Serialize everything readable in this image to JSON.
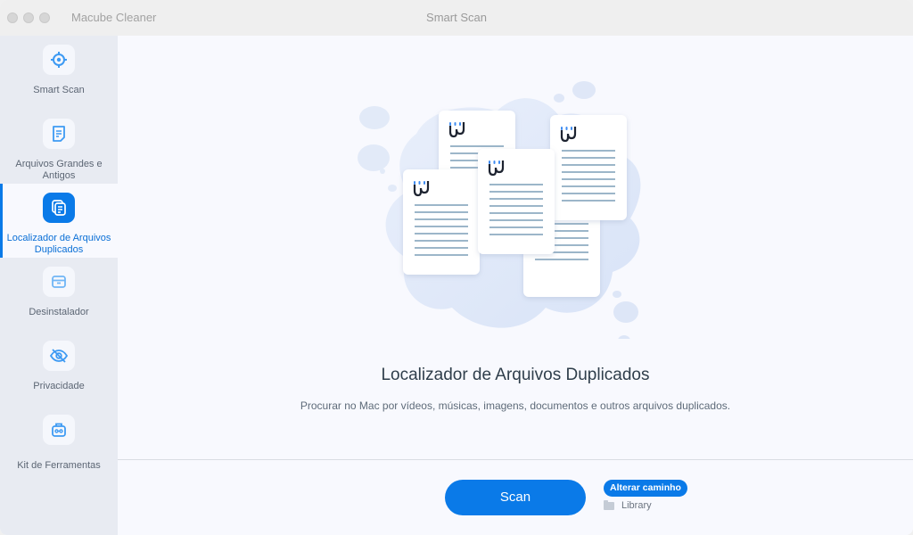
{
  "window": {
    "app_title": "Macube Cleaner",
    "title": "Smart Scan"
  },
  "sidebar": {
    "items": [
      {
        "label": "Smart Scan",
        "icon": "target-icon",
        "active": false
      },
      {
        "label": "Arquivos Grandes e Antigos",
        "icon": "document-icon",
        "active": false
      },
      {
        "label": "Localizador de Arquivos Duplicados",
        "icon": "duplicate-files-icon",
        "active": true
      },
      {
        "label": "Desinstalador",
        "icon": "box-icon",
        "active": false
      },
      {
        "label": "Privacidade",
        "icon": "eye-off-icon",
        "active": false
      },
      {
        "label": "Kit de Ferramentas",
        "icon": "toolbox-icon",
        "active": false
      }
    ]
  },
  "main": {
    "title": "Localizador de Arquivos Duplicados",
    "description": "Procurar no Mac por vídeos, músicas, imagens, documentos e outros arquivos duplicados.",
    "scan_label": "Scan",
    "change_path_label": "Alterar caminho",
    "path": "Library"
  },
  "colors": {
    "accent": "#0a7ae8",
    "sidebar_bg": "#e8ebf2",
    "main_bg": "#f8f9fe"
  }
}
